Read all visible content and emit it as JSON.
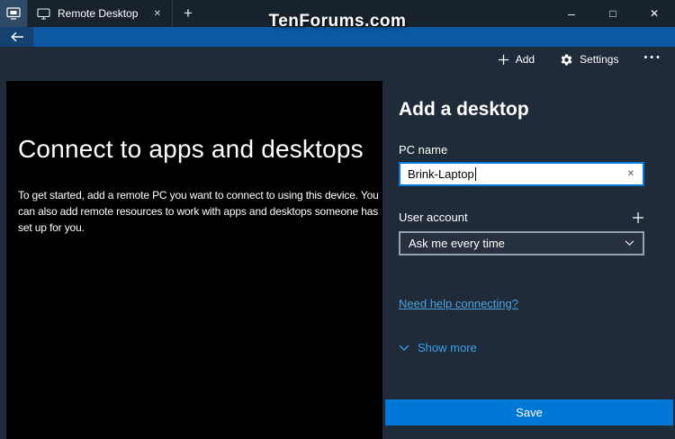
{
  "window": {
    "tab_title": "Remote Desktop",
    "watermark": "TenForums.com"
  },
  "titlebar_icons": {
    "new_tab": "+",
    "tab_close": "✕",
    "minimize": "–",
    "maximize": "□",
    "close": "✕"
  },
  "toolbar": {
    "add_label": "Add",
    "settings_label": "Settings",
    "more_glyph": "•••"
  },
  "left_panel": {
    "title": "Connect to apps and desktops",
    "description": "To get started, add a remote PC you want to connect to using this device. You can also add remote resources to work with apps and desktops someone has set up for you."
  },
  "form": {
    "title": "Add a desktop",
    "pc_name_label": "PC name",
    "pc_name_value": "Brink-Laptop",
    "clear_glyph": "✕",
    "user_account_label": "User account",
    "user_account_value": "Ask me every time",
    "help_link": "Need help connecting?",
    "show_more_label": "Show more",
    "save_label": "Save"
  },
  "colors": {
    "accent": "#0078d7",
    "link": "#4aa0e0",
    "titlebar": "#18222d",
    "nav_strip": "#0b5aa1",
    "background": "#202b39",
    "left_panel": "#000000"
  }
}
